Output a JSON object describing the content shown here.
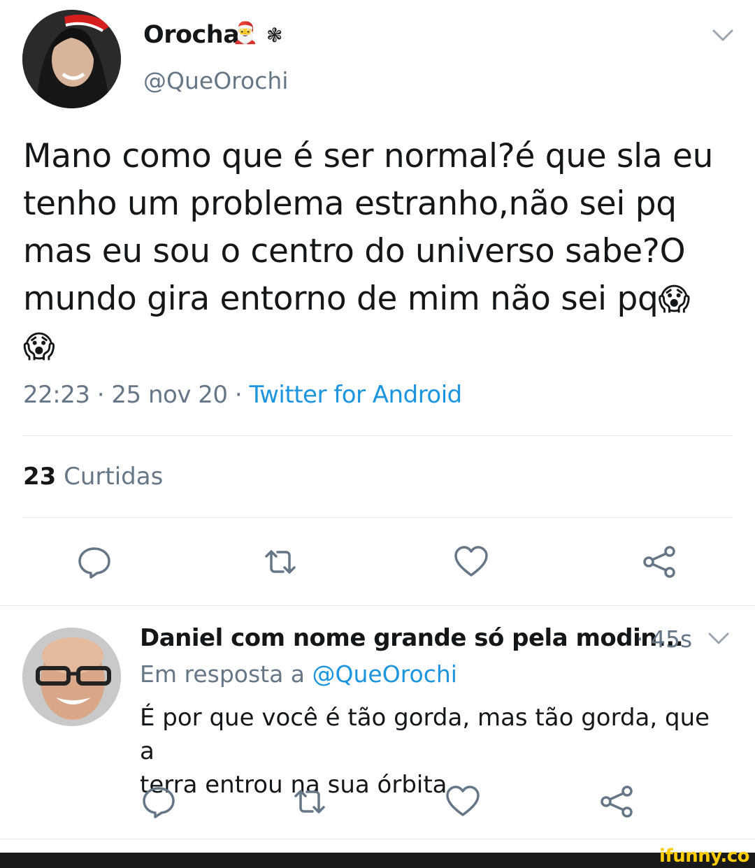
{
  "tweet": {
    "display_name": "Orocha",
    "name_emoji": "🎅",
    "name_symbol": "❃",
    "handle": "@QueOrochi",
    "text_lines": [
      "Mano como que é ser normal?é que sla eu",
      "tenho um problema estranho,não sei pq",
      "mas eu sou o centro do universo sabe?O",
      "mundo gira entorno de mim não sei pq"
    ],
    "emoji": "😱",
    "time": "22:23",
    "date": "25 nov 20",
    "separator": "·",
    "source": "Twitter for Android",
    "likes_count": "23",
    "likes_label": "Curtidas"
  },
  "reply": {
    "display_name": "Daniel com nome grande só pela modin...",
    "time": "· 45s",
    "reply_prefix": "Em resposta a",
    "reply_handle": "@QueOrochi",
    "text_line1": "É por que você é tão gorda, mas tão gorda, que a",
    "text_line2": "terra entrou na sua órbita"
  },
  "actions": [
    "reply-icon",
    "retweet-icon",
    "like-icon",
    "share-icon"
  ],
  "colors": {
    "link": "#1b95e0",
    "secondary_text": "#657786",
    "icon": "#657786",
    "divider": "#e1e8ed"
  },
  "watermark": "ifunny.co"
}
